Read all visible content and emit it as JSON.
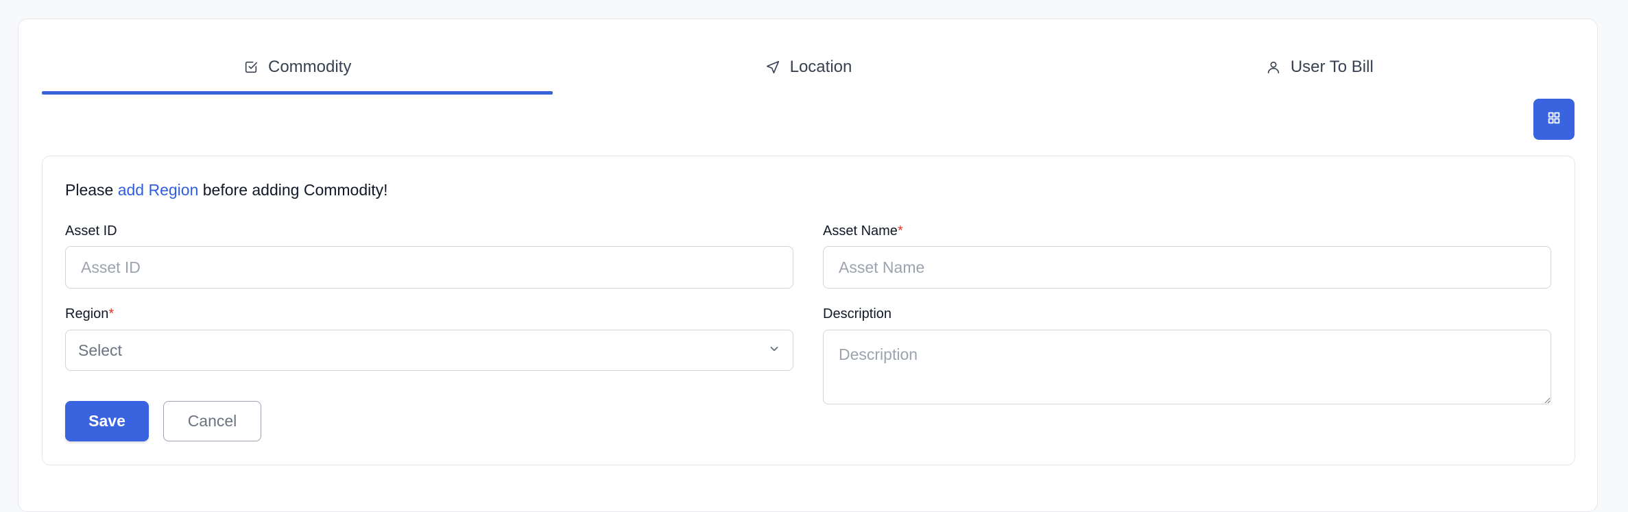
{
  "tabs": [
    {
      "label": "Commodity",
      "icon": "checkbox-icon",
      "active": true
    },
    {
      "label": "Location",
      "icon": "navigation-arrow-icon",
      "active": false
    },
    {
      "label": "User To Bill",
      "icon": "user-icon",
      "active": false
    }
  ],
  "toolbar": {
    "grid_button_icon": "grid-icon"
  },
  "notice": {
    "prefix": "Please ",
    "link": "add Region",
    "suffix": " before adding Commodity!"
  },
  "form": {
    "asset_id": {
      "label": "Asset ID",
      "placeholder": "Asset ID",
      "value": ""
    },
    "asset_name": {
      "label": "Asset Name",
      "required_mark": "*",
      "placeholder": "Asset Name",
      "value": ""
    },
    "region": {
      "label": "Region",
      "required_mark": "*",
      "selected": "Select"
    },
    "description": {
      "label": "Description",
      "placeholder": "Description",
      "value": ""
    }
  },
  "actions": {
    "save_label": "Save",
    "cancel_label": "Cancel"
  },
  "colors": {
    "accent": "#3a63e0",
    "required": "#e5342c",
    "link": "#2f5fe0"
  }
}
